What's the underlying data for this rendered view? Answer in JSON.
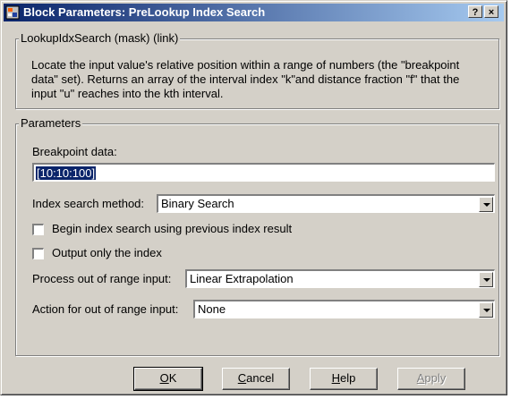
{
  "window": {
    "title": "Block Parameters: PreLookup Index Search",
    "help_button": "?",
    "close_button": "×"
  },
  "mask_group": {
    "legend": "LookupIdxSearch (mask) (link)",
    "description": "Locate the input value's relative position within a range of numbers (the \"breakpoint data\" set).  Returns an array of the interval index \"k\"and distance fraction \"f\" that the input \"u\" reaches into the kth interval."
  },
  "params_group": {
    "legend": "Parameters",
    "breakpoint_label": "Breakpoint data:",
    "breakpoint_value": "[10:10:100]",
    "index_method_label": "Index search method:",
    "index_method_value": "Binary Search",
    "begin_search_label": "Begin index search using previous index result",
    "begin_search_checked": false,
    "output_index_label": "Output only the index",
    "output_index_checked": false,
    "process_label": "Process out of range input:",
    "process_value": "Linear Extrapolation",
    "action_label": "Action for out of range input:",
    "action_value": "None"
  },
  "buttons": {
    "ok": {
      "prefix": "",
      "mnemonic": "O",
      "rest": "K"
    },
    "cancel": {
      "prefix": "",
      "mnemonic": "C",
      "rest": "ancel"
    },
    "help": {
      "prefix": "",
      "mnemonic": "H",
      "rest": "elp"
    },
    "apply": {
      "prefix": "",
      "mnemonic": "A",
      "rest": "pply"
    }
  },
  "colors": {
    "title_start": "#0a246a",
    "title_end": "#a6caf0",
    "face": "#d4d0c8",
    "selection": "#0a246a"
  }
}
